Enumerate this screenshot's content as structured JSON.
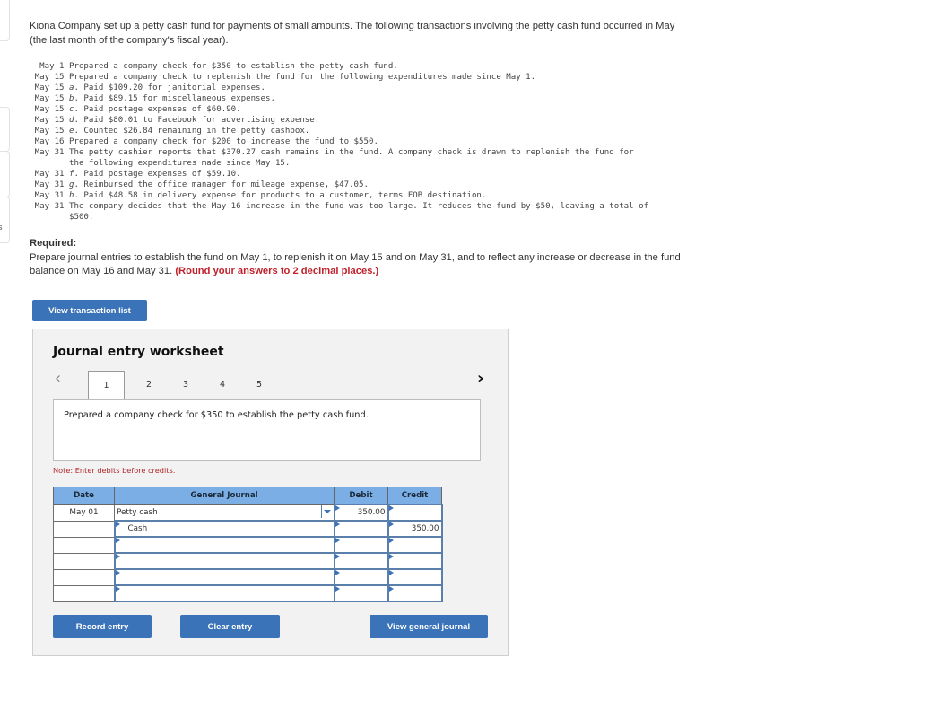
{
  "intro": "Kiona Company set up a petty cash fund for payments of small amounts. The following transactions involving the petty cash fund occurred in May (the last month of the company's fiscal year).",
  "transactions": [
    {
      "date": "May 1",
      "letter": "",
      "text": "Prepared a company check for $350 to establish the petty cash fund."
    },
    {
      "date": "May 15",
      "letter": "",
      "text": "Prepared a company check to replenish the fund for the following expenditures made since May 1."
    },
    {
      "date": "May 15",
      "letter": "a",
      "text": ". Paid $109.20 for janitorial expenses."
    },
    {
      "date": "May 15",
      "letter": "b",
      "text": ". Paid $89.15 for miscellaneous expenses."
    },
    {
      "date": "May 15",
      "letter": "c",
      "text": ". Paid postage expenses of $60.90."
    },
    {
      "date": "May 15",
      "letter": "d",
      "text": ". Paid $80.01 to Facebook for advertising expense."
    },
    {
      "date": "May 15",
      "letter": "e",
      "text": ". Counted $26.84 remaining in the petty cashbox."
    },
    {
      "date": "May 16",
      "letter": "",
      "text": "Prepared a company check for $200 to increase the fund to $550."
    },
    {
      "date": "May 31",
      "letter": "",
      "text": "The petty cashier reports that $370.27 cash remains in the fund. A company check is drawn to replenish the fund for\nthe following expenditures made since May 15."
    },
    {
      "date": "May 31",
      "letter": "f",
      "text": ". Paid postage expenses of $59.10."
    },
    {
      "date": "May 31",
      "letter": "g",
      "text": ". Reimbursed the office manager for mileage expense, $47.05."
    },
    {
      "date": "May 31",
      "letter": "h",
      "text": ". Paid $48.58 in delivery expense for products to a customer, terms FOB destination."
    },
    {
      "date": "May 31",
      "letter": "",
      "text": "The company decides that the May 16 increase in the fund was too large. It reduces the fund by $50, leaving a total of\n$500."
    }
  ],
  "required": {
    "label": "Required:",
    "text": "Prepare journal entries to establish the fund on May 1, to replenish it on May 15 and on May 31, and to reflect any increase or decrease in the fund balance on May 16 and May 31. ",
    "emphasis": "(Round your answers to 2 decimal places.)"
  },
  "buttons": {
    "view_transaction_list": "View transaction list",
    "record_entry": "Record entry",
    "clear_entry": "Clear entry",
    "view_general_journal": "View general journal"
  },
  "worksheet": {
    "title": "Journal entry worksheet",
    "tabs": [
      "1",
      "2",
      "3",
      "4",
      "5"
    ],
    "active_tab": "1",
    "description": "Prepared a company check for $350 to establish the petty cash fund.",
    "note": "Note: Enter debits before credits.",
    "columns": {
      "date": "Date",
      "journal": "General Journal",
      "debit": "Debit",
      "credit": "Credit"
    },
    "rows": [
      {
        "date": "May 01",
        "account": "Petty cash",
        "debit": "350.00",
        "credit": ""
      },
      {
        "date": "",
        "account": "Cash",
        "debit": "",
        "credit": "350.00"
      },
      {
        "date": "",
        "account": "",
        "debit": "",
        "credit": ""
      },
      {
        "date": "",
        "account": "",
        "debit": "",
        "credit": ""
      },
      {
        "date": "",
        "account": "",
        "debit": "",
        "credit": ""
      },
      {
        "date": "",
        "account": "",
        "debit": "",
        "credit": ""
      }
    ]
  },
  "colors": {
    "button": "#3a73b8",
    "header": "#7aaee4",
    "warning": "#c0202a"
  }
}
